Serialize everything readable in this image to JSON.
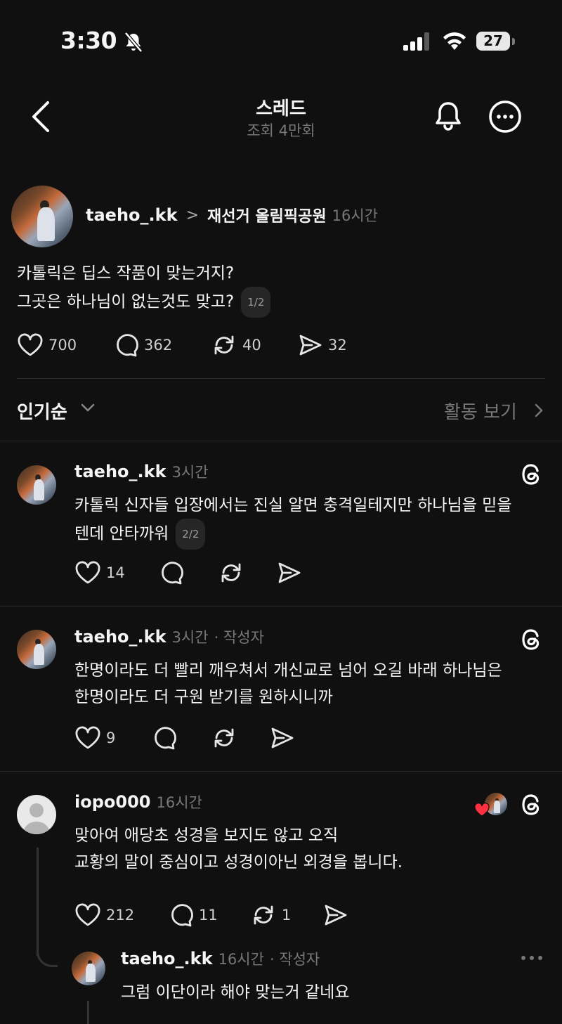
{
  "status_bar": {
    "time": "3:30",
    "battery": "27"
  },
  "header": {
    "title": "스레드",
    "subtitle": "조회 4만회"
  },
  "post": {
    "username": "taeho_.kk",
    "separator": ">",
    "location": "재선거 올림픽공원",
    "time": "16시간",
    "lines": [
      "카톨릭은 딥스 작품이 맞는거지?",
      "그곳은 하나님이 없는것도 맞고?"
    ],
    "pill": "1/2",
    "likes": "700",
    "comments": "362",
    "reposts": "40",
    "shares": "32"
  },
  "sort": {
    "label": "인기순",
    "activity_label": "활동 보기"
  },
  "replies": [
    {
      "username": "taeho_.kk",
      "time": "3시간",
      "author_tag": "",
      "lines": [
        "카톨릭 신자들 입장에서는 진실 알면 충격일테지만 하나님을 믿을",
        "텐데 안타까워"
      ],
      "pill": "2/2",
      "likes": "14"
    },
    {
      "username": "taeho_.kk",
      "time": "3시간",
      "author_tag": "· 작성자",
      "lines": [
        "한명이라도 더 빨리 깨우쳐서 개신교로 넘어 오길 바래 하나님은",
        "한명이라도 더 구원 받기를 원하시니까"
      ],
      "likes": "9"
    },
    {
      "username": "iopo000",
      "time": "16시간",
      "lines": [
        "맞아여 애당초 성경을 보지도 않고 오직",
        "교황의 말이 중심이고 성경이아닌 외경을 봅니다."
      ],
      "likes": "212",
      "comments": "11",
      "reposts": "1"
    }
  ],
  "nested_reply": {
    "username": "taeho_.kk",
    "time": "16시간",
    "author_tag": "· 작성자",
    "text": "그럼 이단이라 해야 맞는거 같네요"
  }
}
